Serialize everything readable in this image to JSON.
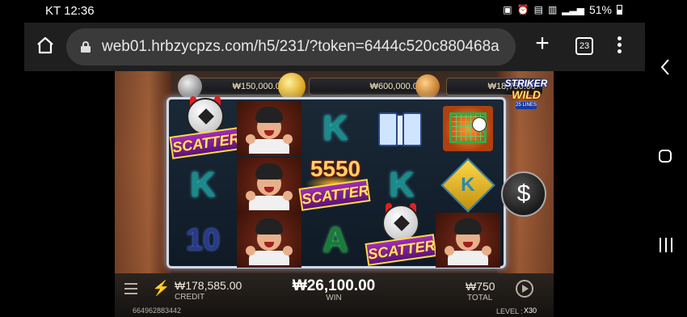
{
  "status_bar": {
    "time": "KT 12:36",
    "battery": "51%",
    "icons": [
      "notification-icon",
      "alarm-icon",
      "hd-icon",
      "5g-icon",
      "signal-icon",
      "battery-icon"
    ]
  },
  "browser": {
    "url": "web01.hrbzycpzs.com/h5/231/?token=6444c520c880468a",
    "tab_count": "23"
  },
  "game": {
    "title_line1": "STRIKER",
    "title_line2": "WILD",
    "title_badge": "25 LINES",
    "jackpots": [
      {
        "tier": "silver",
        "value": "₩150,000.00"
      },
      {
        "tier": "gold",
        "value": "₩600,000.00"
      },
      {
        "tier": "bronze",
        "value": "₩18,750.00"
      }
    ],
    "symbols": {
      "k": "K",
      "ten": "10",
      "a": "A",
      "scatter": "SCATTER",
      "scatter_win": "5550"
    },
    "dollar_button": "$",
    "credit_value": "₩178,585.00",
    "credit_label": "CREDIT",
    "win_value": "₩26,100.00",
    "win_label": "WIN",
    "total_value": "₩750",
    "total_label": "TOTAL",
    "round_id": "664962883442",
    "level_label": "LEVEL :",
    "level_value": "X30"
  },
  "colors": {
    "browser_bar": "#1f1f1f",
    "url_box": "#3a3a3a",
    "gold": "#ffd84a",
    "scatter_purple": "#a02cc0"
  }
}
